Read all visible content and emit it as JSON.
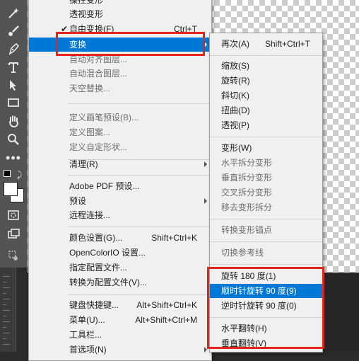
{
  "main_menu": {
    "items": [
      {
        "label": "操控变形",
        "shortcut": "",
        "disabled": false
      },
      {
        "label": "透视变形",
        "shortcut": "",
        "disabled": false
      },
      {
        "label": "自由变换(F)",
        "shortcut": "Ctrl+T",
        "disabled": false,
        "checked": true
      },
      {
        "label": "变换",
        "shortcut": "",
        "disabled": false,
        "submenu": true,
        "highlighted": true
      },
      {
        "label": "自动对齐图层...",
        "shortcut": "",
        "disabled": true
      },
      {
        "label": "自动混合图层...",
        "shortcut": "",
        "disabled": true
      },
      {
        "label": "天空替换...",
        "shortcut": "",
        "disabled": true
      },
      {
        "label": "定义画笔预设(B)...",
        "shortcut": "",
        "disabled": true
      },
      {
        "label": "定义图案...",
        "shortcut": "",
        "disabled": true
      },
      {
        "label": "定义自定形状...",
        "shortcut": "",
        "disabled": true
      },
      {
        "label": "清理(R)",
        "shortcut": "",
        "disabled": false,
        "submenu": true
      },
      {
        "label": "Adobe PDF 预设...",
        "shortcut": "",
        "disabled": false
      },
      {
        "label": "预设",
        "shortcut": "",
        "disabled": false,
        "submenu": true
      },
      {
        "label": "远程连接...",
        "shortcut": "",
        "disabled": false
      },
      {
        "label": "颜色设置(G)...",
        "shortcut": "Shift+Ctrl+K",
        "disabled": false
      },
      {
        "label": "OpenColorIO 设置...",
        "shortcut": "",
        "disabled": false
      },
      {
        "label": "指定配置文件...",
        "shortcut": "",
        "disabled": false
      },
      {
        "label": "转换为配置文件(V)...",
        "shortcut": "",
        "disabled": false
      },
      {
        "label": "键盘快捷键...",
        "shortcut": "Alt+Shift+Ctrl+K",
        "disabled": false
      },
      {
        "label": "菜单(U)...",
        "shortcut": "Alt+Shift+Ctrl+M",
        "disabled": false
      },
      {
        "label": "工具栏...",
        "shortcut": "",
        "disabled": false
      },
      {
        "label": "首选项(N)",
        "shortcut": "",
        "disabled": false,
        "submenu": true
      }
    ]
  },
  "transform_submenu": {
    "items": [
      {
        "label": "再次(A)",
        "shortcut": "Shift+Ctrl+T",
        "disabled": false
      },
      {
        "label": "缩放(S)",
        "shortcut": "",
        "disabled": false
      },
      {
        "label": "旋转(R)",
        "shortcut": "",
        "disabled": false
      },
      {
        "label": "斜切(K)",
        "shortcut": "",
        "disabled": false
      },
      {
        "label": "扭曲(D)",
        "shortcut": "",
        "disabled": false
      },
      {
        "label": "透视(P)",
        "shortcut": "",
        "disabled": false
      },
      {
        "label": "变形(W)",
        "shortcut": "",
        "disabled": false
      },
      {
        "label": "水平拆分变形",
        "shortcut": "",
        "disabled": true
      },
      {
        "label": "垂直拆分变形",
        "shortcut": "",
        "disabled": true
      },
      {
        "label": "交叉拆分变形",
        "shortcut": "",
        "disabled": true
      },
      {
        "label": "移去变形拆分",
        "shortcut": "",
        "disabled": true
      },
      {
        "label": "转换变形锚点",
        "shortcut": "",
        "disabled": true
      },
      {
        "label": "切换参考线",
        "shortcut": "",
        "disabled": true
      },
      {
        "label": "旋转 180 度(1)",
        "shortcut": "",
        "disabled": false
      },
      {
        "label": "顺时针旋转 90 度(9)",
        "shortcut": "",
        "disabled": false,
        "highlighted": true
      },
      {
        "label": "逆时针旋转 90 度(0)",
        "shortcut": "",
        "disabled": false
      },
      {
        "label": "水平翻转(H)",
        "shortcut": "",
        "disabled": false
      },
      {
        "label": "垂直翻转(V)",
        "shortcut": "",
        "disabled": false
      }
    ]
  },
  "toolbar": {
    "tools": [
      "wand-icon",
      "brush-icon",
      "pen-icon",
      "type-icon",
      "select-arrow-icon",
      "rectangle-icon",
      "hand-icon",
      "zoom-icon",
      "more-tools-icon"
    ],
    "colors": {
      "foreground": "#000000",
      "background": "#ffffff"
    }
  },
  "colors": {
    "highlight": "#0078d7",
    "annotation_box": "#e2261c"
  }
}
